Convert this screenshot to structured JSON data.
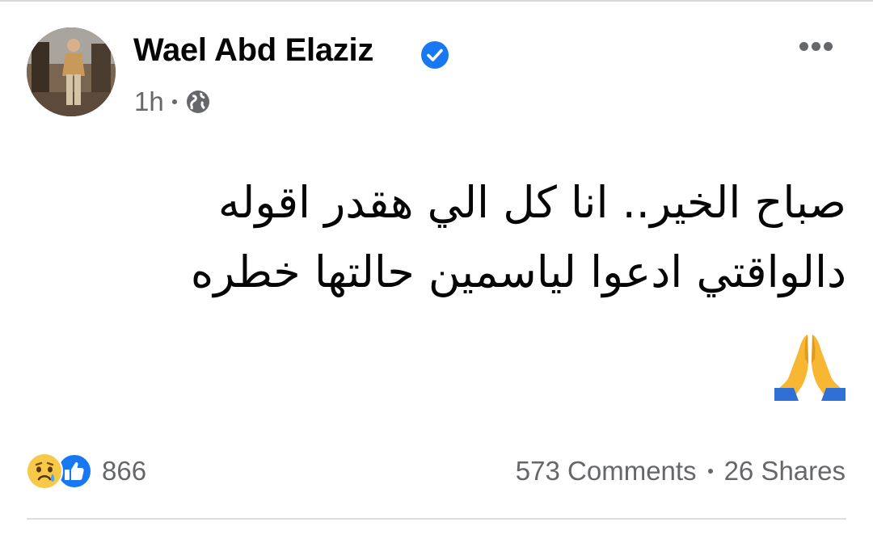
{
  "post": {
    "author": {
      "name": "Wael Abd Elaziz",
      "verified": true,
      "avatar_icon": "profile-photo"
    },
    "meta": {
      "time": "1h",
      "privacy_icon": "globe-icon"
    },
    "more_icon": "more-horizontal-icon",
    "text_lines": [
      "صباح الخير.. انا كل الي هقدر اقوله",
      "دالواقتي ادعوا لياسمين حالتها خطره"
    ],
    "emoji": "🙏",
    "reactions": {
      "icons": [
        "sad-reaction-icon",
        "like-reaction-icon"
      ],
      "count": "866"
    },
    "comments": "573 Comments",
    "shares": "26 Shares"
  },
  "colors": {
    "text_primary": "#050505",
    "text_secondary": "#65676b",
    "verified_blue": "#1877f2",
    "divider": "#dadde1"
  }
}
